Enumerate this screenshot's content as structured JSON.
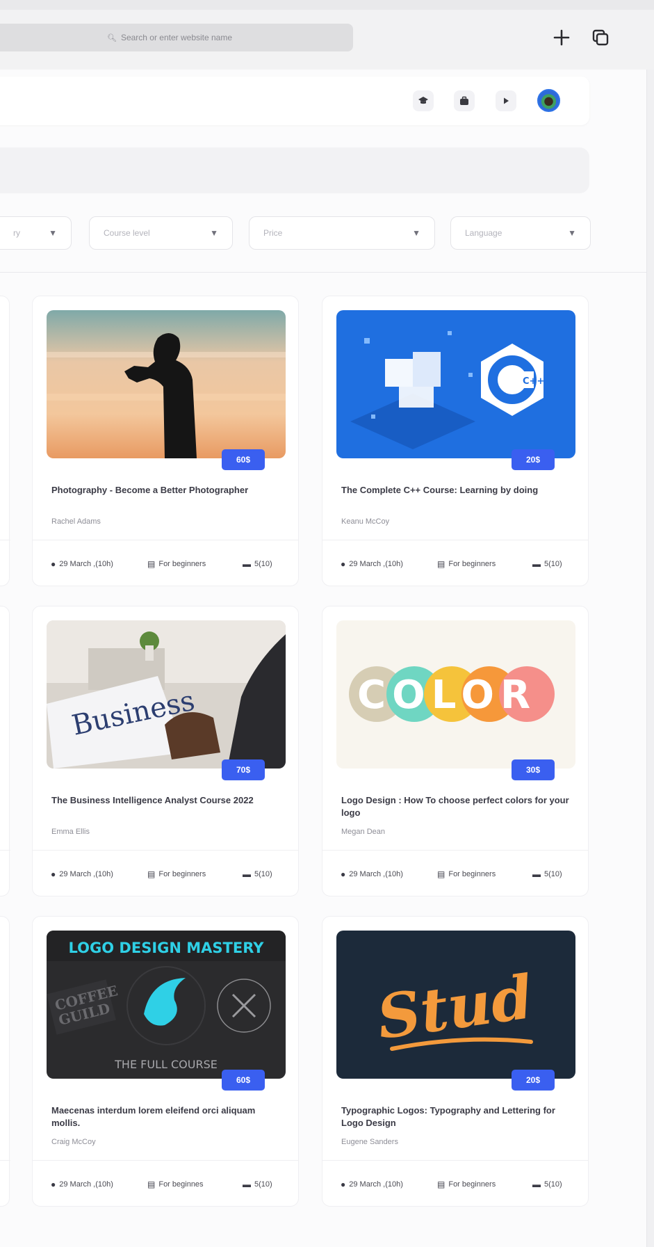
{
  "browser": {
    "address_placeholder": "Search or enter website name",
    "new_tab_icon": "plus-icon",
    "tabs_icon": "tabs-overview-icon"
  },
  "header": {
    "icons": [
      "graduation-cap-icon",
      "briefcase-icon",
      "play-icon"
    ],
    "avatar": "user-avatar"
  },
  "filters": [
    {
      "label": "ry"
    },
    {
      "label": "Course level"
    },
    {
      "label": "Price"
    },
    {
      "label": "Language"
    }
  ],
  "accent_color": "#3a5ff0",
  "courses": [
    {
      "image": "photographer-silhouette-sunset",
      "price": "60$",
      "title": "Photography - Become a Better Photographer",
      "author": "Rachel Adams",
      "date": "29 March ,(10h)",
      "level": "For beginners",
      "lessons": "5(10)"
    },
    {
      "image": "cpp-logo-blue",
      "image_text": "C++",
      "price": "20$",
      "title": "The Complete C++ Course: Learning by doing",
      "author": "Keanu McCoy",
      "date": "29 March ,(10h)",
      "level": "For beginners",
      "lessons": "5(10)"
    },
    {
      "image": "business-newspaper",
      "image_text": "Business",
      "price": "70$",
      "title": "The Business Intelligence Analyst Course 2022",
      "author": "Emma Ellis",
      "date": "29 March ,(10h)",
      "level": "For beginners",
      "lessons": "5(10)"
    },
    {
      "image": "color-circles-logo",
      "image_text": "COLOR",
      "price": "30$",
      "title": "Logo Design : How To choose perfect colors for your logo",
      "author": "Megan Dean",
      "date": "29 March ,(10h)",
      "level": "For beginners",
      "lessons": "5(10)"
    },
    {
      "image": "logo-design-mastery",
      "image_text": "LOGO DESIGN MASTERY",
      "image_subtext": "THE FULL COURSE",
      "price": "60$",
      "title": "Maecenas interdum lorem eleifend orci aliquam mollis.",
      "author": "Craig McCoy",
      "date": "29 March ,(10h)",
      "level": "For beginnes",
      "lessons": "5(10)"
    },
    {
      "image": "stud-lettering",
      "image_text": "Stud",
      "price": "20$",
      "title": "Typographic Logos: Typography and Lettering for Logo Design",
      "author": "Eugene Sanders",
      "date": "29 March ,(10h)",
      "level": "For beginners",
      "lessons": "5(10)"
    }
  ]
}
